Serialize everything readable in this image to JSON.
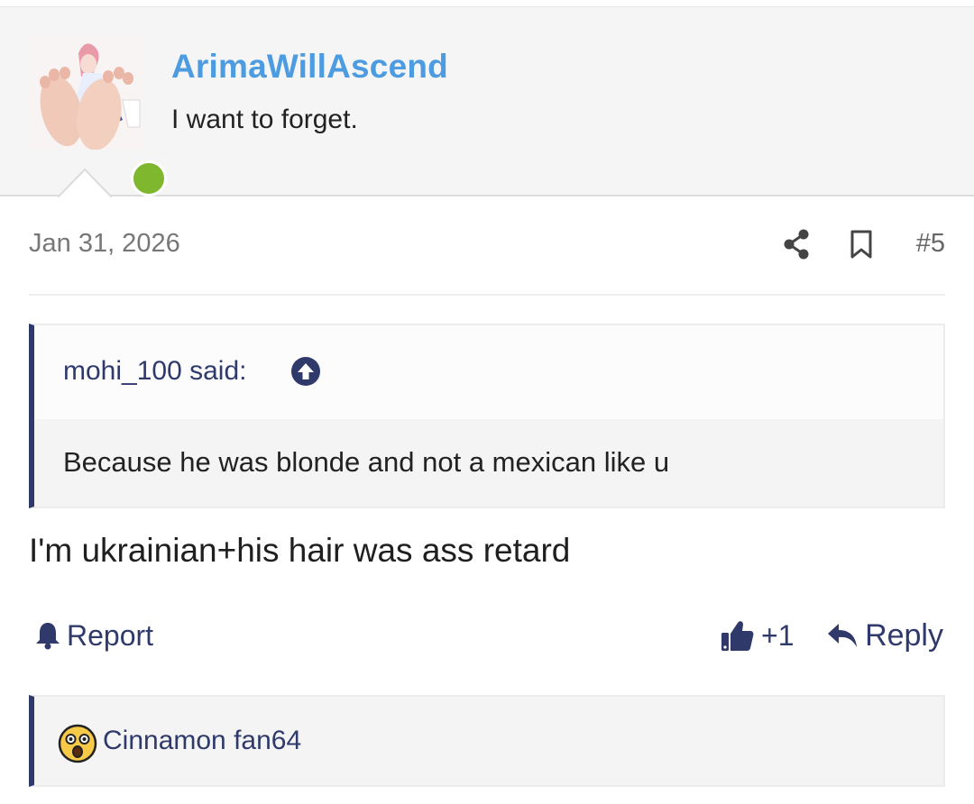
{
  "author": {
    "username": "ArimaWillAscend",
    "title": "I want to forget.",
    "online": true,
    "online_color": "#7fb72e",
    "username_color": "#4d9be0"
  },
  "post": {
    "date": "Jan 31, 2026",
    "number": "#5",
    "quote": {
      "author_said": "mohi_100 said:",
      "text": "Because he was blonde and not a mexican like u"
    },
    "body": "I'm ukrainian+his hair was ass retard"
  },
  "actions": {
    "report_label": "Report",
    "like_count": "+1",
    "reply_label": "Reply"
  },
  "reactions": {
    "users": "Cinnamon fan64",
    "emoji": "astonished-emoji"
  },
  "icons": {
    "share": "share-icon",
    "bookmark": "bookmark-icon",
    "report": "bell-icon",
    "like": "thumbs-up-icon",
    "reply": "reply-arrow-icon",
    "quote_jump": "arrow-up-circle-icon"
  },
  "colors": {
    "accent": "#2f3a6b",
    "header_bg": "#f5f5f5"
  }
}
